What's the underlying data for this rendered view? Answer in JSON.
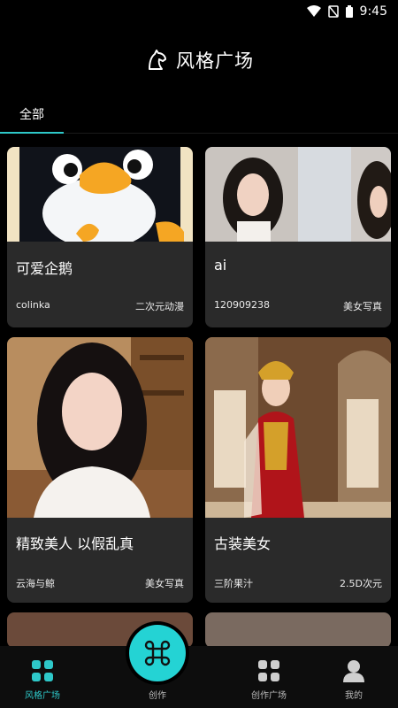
{
  "status_bar": {
    "time": "9:45"
  },
  "header": {
    "title": "风格广场"
  },
  "tabs": [
    {
      "label": "全部"
    }
  ],
  "cards": [
    {
      "title": "可爱企鹅",
      "author": "colinka",
      "tag": "二次元动漫"
    },
    {
      "title": "ai",
      "author": "120909238",
      "tag": "美女写真"
    },
    {
      "title": "精致美人 以假乱真",
      "author": "云海与鲸",
      "tag": "美女写真"
    },
    {
      "title": "古装美女",
      "author": "三阶果汁",
      "tag": "2.5D次元"
    }
  ],
  "bottom_nav": {
    "items": [
      {
        "label": "风格广场"
      },
      {
        "label": "创作"
      },
      {
        "label": "创作广场"
      },
      {
        "label": "我的"
      }
    ]
  },
  "colors": {
    "accent": "#2ec8c9",
    "card_bg": "#2a2a2a",
    "background": "#000000"
  }
}
